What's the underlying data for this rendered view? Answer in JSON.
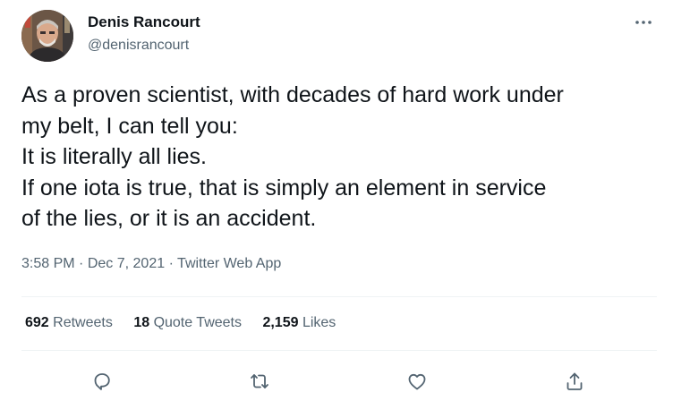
{
  "author": {
    "display_name": "Denis Rancourt",
    "handle": "@denisrancourt"
  },
  "tweet": {
    "lines": [
      "As a proven scientist, with decades of hard work under",
      "my belt, I can tell you:",
      "It is literally all lies.",
      "If one iota is true, that is simply an element in service",
      "of the lies, or it is an accident."
    ],
    "time": "3:58 PM",
    "separator": "·",
    "date": "Dec 7, 2021",
    "source": "Twitter Web App"
  },
  "stats": {
    "retweets": {
      "count": "692",
      "label": "Retweets"
    },
    "quote_tweets": {
      "count": "18",
      "label": "Quote Tweets"
    },
    "likes": {
      "count": "2,159",
      "label": "Likes"
    }
  },
  "actions": [
    "reply-icon",
    "retweet-icon",
    "like-icon",
    "share-icon"
  ],
  "colors": {
    "text": "#0f1419",
    "secondary": "#536471",
    "divider": "#eff3f4",
    "icon": "#536471"
  }
}
